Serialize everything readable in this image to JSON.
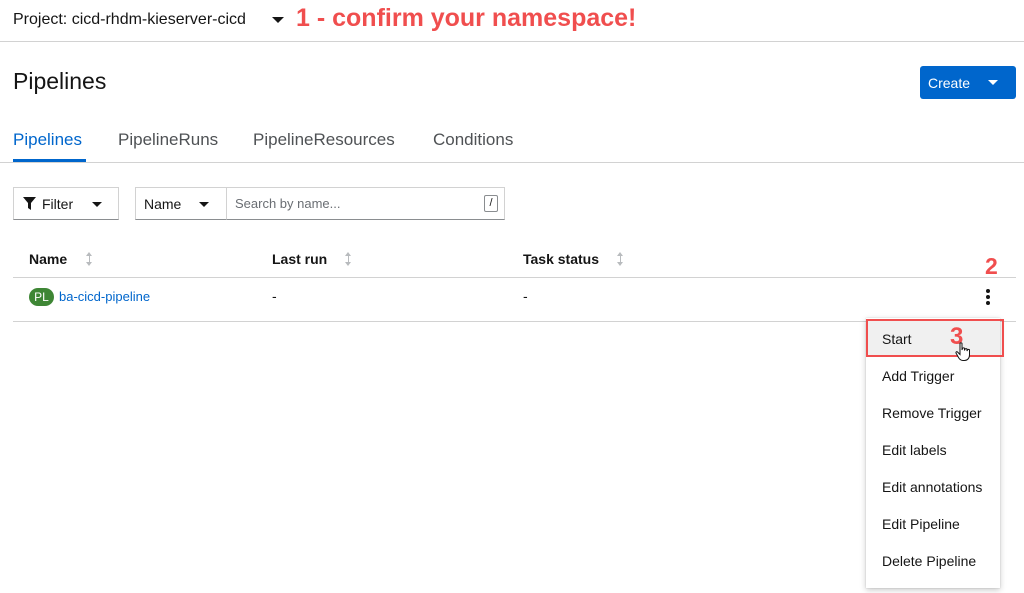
{
  "project": {
    "label": "Project: cicd-rhdm-kieserver-cicd"
  },
  "annotations": {
    "step1": "1 - confirm your namespace!",
    "step2": "2",
    "step3": "3"
  },
  "page": {
    "title": "Pipelines"
  },
  "toolbar": {
    "create_label": "Create"
  },
  "tabs": [
    {
      "label": "Pipelines",
      "active": true
    },
    {
      "label": "PipelineRuns",
      "active": false
    },
    {
      "label": "PipelineResources",
      "active": false
    },
    {
      "label": "Conditions",
      "active": false
    }
  ],
  "filter": {
    "filter_label": "Filter",
    "name_select": "Name",
    "search_placeholder": "Search by name...",
    "shortcut_hint": "/"
  },
  "table": {
    "columns": [
      "Name",
      "Last run",
      "Task status"
    ],
    "rows": [
      {
        "badge": "PL",
        "name": "ba-cicd-pipeline",
        "last_run": "-",
        "task_status": "-"
      }
    ]
  },
  "menu": {
    "items": [
      "Start",
      "Add Trigger",
      "Remove Trigger",
      "Edit labels",
      "Edit annotations",
      "Edit Pipeline",
      "Delete Pipeline"
    ],
    "highlighted_index": 0
  },
  "colors": {
    "primary": "#0066cc",
    "annotation": "#f04e4e",
    "badge": "#3e8635"
  }
}
